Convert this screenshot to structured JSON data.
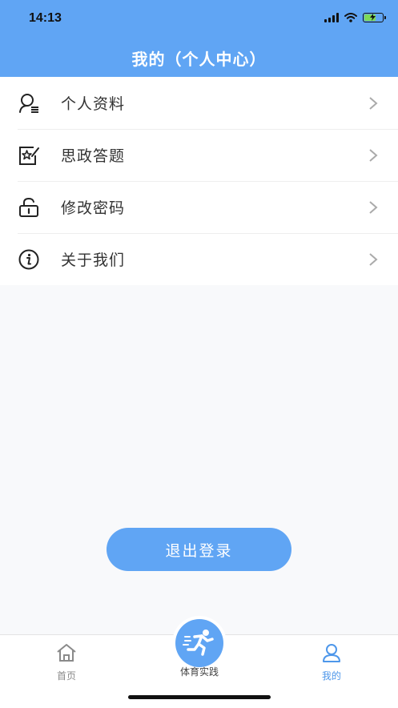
{
  "status_bar": {
    "time": "14:13"
  },
  "header": {
    "title": "我的（个人中心）"
  },
  "menu": {
    "items": [
      {
        "label": "个人资料",
        "icon": "user-profile-icon"
      },
      {
        "label": "思政答题",
        "icon": "star-edit-icon"
      },
      {
        "label": "修改密码",
        "icon": "lock-icon"
      },
      {
        "label": "关于我们",
        "icon": "info-icon"
      }
    ]
  },
  "logout_label": "退出登录",
  "tabbar": {
    "home": "首页",
    "sports": "体育实践",
    "mine": "我的"
  },
  "colors": {
    "accent": "#60a5f4",
    "active_tab": "#4e97ea"
  }
}
